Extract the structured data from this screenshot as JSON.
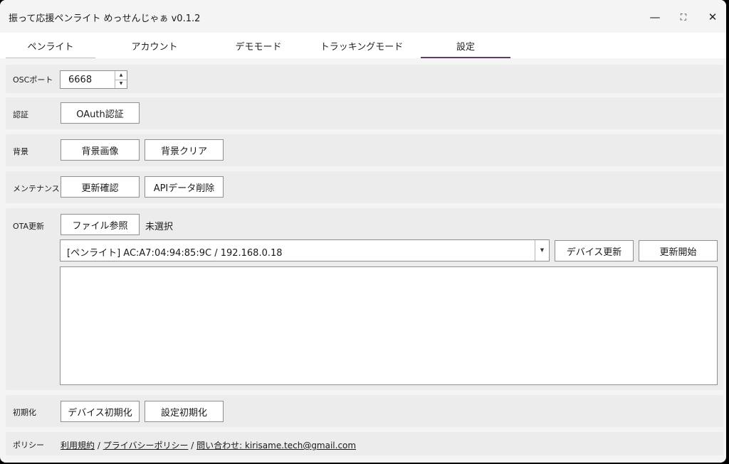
{
  "window": {
    "title": "振って応援ペンライト めっせんじゃぁ v0.1.2",
    "minimize_icon": "—",
    "maximize_icon": "⛶",
    "close_icon": "✕"
  },
  "tabs": [
    {
      "label": "ペンライト"
    },
    {
      "label": "アカウント"
    },
    {
      "label": "デモモード"
    },
    {
      "label": "トラッキングモード"
    },
    {
      "label": "設定",
      "selected": true
    }
  ],
  "settings": {
    "osc": {
      "label": "OSCポート",
      "port": "6668",
      "up": "▲",
      "down": "▼"
    },
    "auth": {
      "label": "認証",
      "oauth_button": "OAuth認証"
    },
    "background": {
      "label": "背景",
      "image_button": "背景画像",
      "clear_button": "背景クリア"
    },
    "maintenance": {
      "label": "メンテナンス",
      "check_update_button": "更新確認",
      "delete_api_button": "APIデータ削除"
    },
    "ota": {
      "label": "OTA更新",
      "file_button": "ファイル参照",
      "file_status": "未選択",
      "device_selected": "[ペンライト] AC:A7:04:94:85:9C / 192.168.0.18",
      "dropdown_arrow": "▼",
      "device_update_button": "デバイス更新",
      "start_update_button": "更新開始",
      "log": ""
    },
    "reset": {
      "label": "初期化",
      "device_reset_button": "デバイス初期化",
      "settings_reset_button": "設定初期化"
    },
    "policy": {
      "label": "ポリシー",
      "terms_link": "利用規約",
      "sep1": " / ",
      "privacy_link": "プライバシーポリシー",
      "sep2": " / ",
      "contact_link": "問い合わせ: kirisame.tech@gmail.com"
    }
  }
}
